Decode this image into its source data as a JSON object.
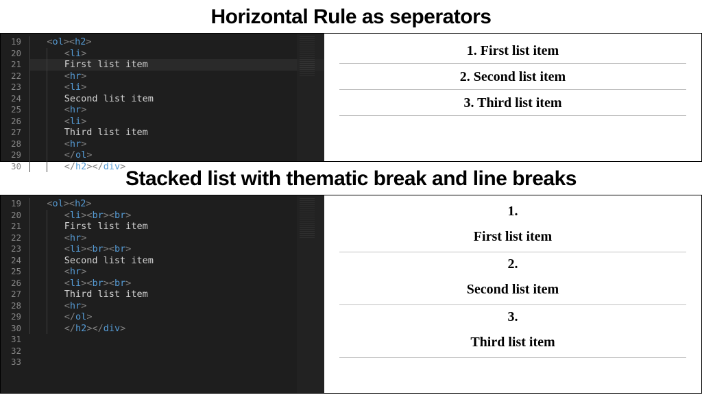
{
  "heading1": "Horizontal Rule as seperators",
  "heading2": "Stacked list with thematic break and line breaks",
  "editor1": {
    "startLine": 19,
    "lines": [
      {
        "indent": 1,
        "tokens": [
          {
            "c": "br",
            "t": "<"
          },
          {
            "c": "tag",
            "t": "ol"
          },
          {
            "c": "br",
            "t": "><"
          },
          {
            "c": "tag",
            "t": "h2"
          },
          {
            "c": "br",
            "t": ">"
          }
        ]
      },
      {
        "indent": 2,
        "tokens": [
          {
            "c": "br",
            "t": "<"
          },
          {
            "c": "tag",
            "t": "li"
          },
          {
            "c": "br",
            "t": ">"
          }
        ]
      },
      {
        "indent": 2,
        "hl": true,
        "tokens": [
          {
            "c": "txt",
            "t": "First list item"
          }
        ]
      },
      {
        "indent": 2,
        "tokens": [
          {
            "c": "br",
            "t": "<"
          },
          {
            "c": "tag",
            "t": "hr"
          },
          {
            "c": "br",
            "t": ">"
          }
        ]
      },
      {
        "indent": 2,
        "tokens": [
          {
            "c": "br",
            "t": "<"
          },
          {
            "c": "tag",
            "t": "li"
          },
          {
            "c": "br",
            "t": ">"
          }
        ]
      },
      {
        "indent": 2,
        "tokens": [
          {
            "c": "txt",
            "t": "Second list item"
          }
        ]
      },
      {
        "indent": 2,
        "tokens": [
          {
            "c": "br",
            "t": "<"
          },
          {
            "c": "tag",
            "t": "hr"
          },
          {
            "c": "br",
            "t": ">"
          }
        ]
      },
      {
        "indent": 2,
        "tokens": [
          {
            "c": "br",
            "t": "<"
          },
          {
            "c": "tag",
            "t": "li"
          },
          {
            "c": "br",
            "t": ">"
          }
        ]
      },
      {
        "indent": 2,
        "tokens": [
          {
            "c": "txt",
            "t": "Third list item"
          }
        ]
      },
      {
        "indent": 2,
        "tokens": [
          {
            "c": "br",
            "t": "<"
          },
          {
            "c": "tag",
            "t": "hr"
          },
          {
            "c": "br",
            "t": ">"
          }
        ]
      },
      {
        "indent": 2,
        "tokens": [
          {
            "c": "br",
            "t": "</"
          },
          {
            "c": "tag",
            "t": "ol"
          },
          {
            "c": "br",
            "t": ">"
          }
        ]
      },
      {
        "indent": 2,
        "tokens": [
          {
            "c": "br",
            "t": "</"
          },
          {
            "c": "tag",
            "t": "h2"
          },
          {
            "c": "br",
            "t": "></"
          },
          {
            "c": "tag",
            "t": "div"
          },
          {
            "c": "br",
            "t": ">"
          }
        ]
      }
    ]
  },
  "editor2": {
    "startLine": 19,
    "lines": [
      {
        "indent": 1,
        "tokens": [
          {
            "c": "br",
            "t": "<"
          },
          {
            "c": "tag",
            "t": "ol"
          },
          {
            "c": "br",
            "t": "><"
          },
          {
            "c": "tag",
            "t": "h2"
          },
          {
            "c": "br",
            "t": ">"
          }
        ]
      },
      {
        "indent": 2,
        "tokens": [
          {
            "c": "br",
            "t": "<"
          },
          {
            "c": "tag",
            "t": "li"
          },
          {
            "c": "br",
            "t": "><"
          },
          {
            "c": "tag",
            "t": "br"
          },
          {
            "c": "br",
            "t": "><"
          },
          {
            "c": "tag",
            "t": "br"
          },
          {
            "c": "br",
            "t": ">"
          }
        ]
      },
      {
        "indent": 2,
        "tokens": [
          {
            "c": "txt",
            "t": "First list item"
          }
        ]
      },
      {
        "indent": 2,
        "tokens": [
          {
            "c": "br",
            "t": "<"
          },
          {
            "c": "tag",
            "t": "hr"
          },
          {
            "c": "br",
            "t": ">"
          }
        ]
      },
      {
        "indent": 2,
        "tokens": [
          {
            "c": "br",
            "t": "<"
          },
          {
            "c": "tag",
            "t": "li"
          },
          {
            "c": "br",
            "t": "><"
          },
          {
            "c": "tag",
            "t": "br"
          },
          {
            "c": "br",
            "t": "><"
          },
          {
            "c": "tag",
            "t": "br"
          },
          {
            "c": "br",
            "t": ">"
          }
        ]
      },
      {
        "indent": 2,
        "tokens": [
          {
            "c": "txt",
            "t": "Second list item"
          }
        ]
      },
      {
        "indent": 2,
        "tokens": [
          {
            "c": "br",
            "t": "<"
          },
          {
            "c": "tag",
            "t": "hr"
          },
          {
            "c": "br",
            "t": ">"
          }
        ]
      },
      {
        "indent": 2,
        "tokens": [
          {
            "c": "br",
            "t": "<"
          },
          {
            "c": "tag",
            "t": "li"
          },
          {
            "c": "br",
            "t": "><"
          },
          {
            "c": "tag",
            "t": "br"
          },
          {
            "c": "br",
            "t": "><"
          },
          {
            "c": "tag",
            "t": "br"
          },
          {
            "c": "br",
            "t": ">"
          }
        ]
      },
      {
        "indent": 2,
        "tokens": [
          {
            "c": "txt",
            "t": "Third list item"
          }
        ]
      },
      {
        "indent": 2,
        "tokens": [
          {
            "c": "br",
            "t": "<"
          },
          {
            "c": "tag",
            "t": "hr"
          },
          {
            "c": "br",
            "t": ">"
          }
        ]
      },
      {
        "indent": 2,
        "tokens": [
          {
            "c": "br",
            "t": "</"
          },
          {
            "c": "tag",
            "t": "ol"
          },
          {
            "c": "br",
            "t": ">"
          }
        ]
      },
      {
        "indent": 2,
        "tokens": [
          {
            "c": "br",
            "t": "</"
          },
          {
            "c": "tag",
            "t": "h2"
          },
          {
            "c": "br",
            "t": "></"
          },
          {
            "c": "tag",
            "t": "div"
          },
          {
            "c": "br",
            "t": ">"
          }
        ]
      },
      {
        "indent": 0,
        "tokens": []
      },
      {
        "indent": 0,
        "tokens": []
      },
      {
        "indent": 0,
        "tokens": []
      }
    ]
  },
  "output1": {
    "items": [
      {
        "n": "1.",
        "t": "First list item"
      },
      {
        "n": "2.",
        "t": "Second list item"
      },
      {
        "n": "3.",
        "t": "Third list item"
      }
    ]
  },
  "output2": {
    "items": [
      {
        "n": "1.",
        "t": "First list item"
      },
      {
        "n": "2.",
        "t": "Second list item"
      },
      {
        "n": "3.",
        "t": "Third list item"
      }
    ]
  }
}
